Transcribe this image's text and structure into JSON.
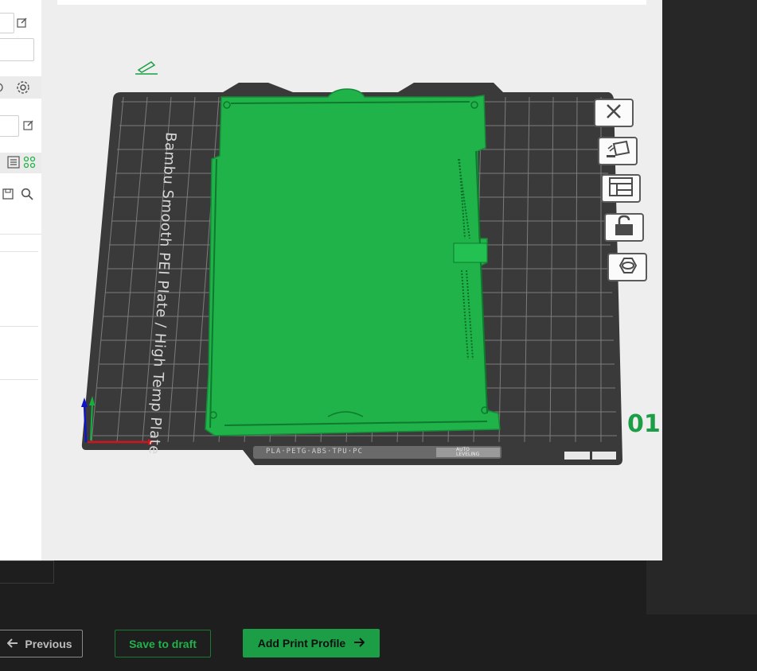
{
  "window": {
    "title": ""
  },
  "plate": {
    "name": "Bambu Smooth PEI Plate / High Temp Plate",
    "filament_label": "PLA·PETG·ABS·TPU·PC",
    "auto_label": "AUTO LEVELING",
    "number": "01"
  },
  "toolbar": {
    "icons": [
      "close-icon",
      "auto-orient-icon",
      "arrange-icon",
      "lock-icon",
      "settings-hex-icon"
    ]
  },
  "sidebar": {
    "icons": [
      "edit-icon",
      "settings-icon",
      "edit-icon",
      "list-icon",
      "connect-icon",
      "save-icon",
      "search-icon"
    ]
  },
  "footer": {
    "previous_label": "Previous",
    "save_draft_label": "Save to draft",
    "add_profile_label": "Add Print Profile"
  },
  "colors": {
    "accent": "#1c9e46",
    "model": "#1fb34a",
    "plate": "#3a3a3a",
    "grid": "#8a8a8a",
    "background": "#1e1e1e"
  }
}
